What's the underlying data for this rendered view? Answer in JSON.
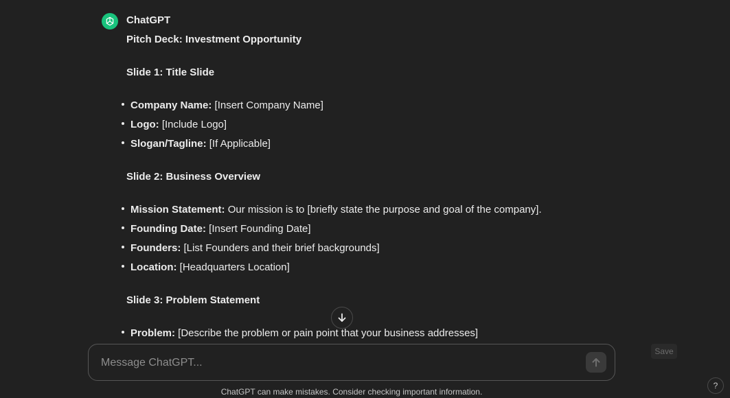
{
  "message": {
    "author": "ChatGPT",
    "avatar_icon": "openai-logo-icon",
    "avatar_color": "#19c37d",
    "title": "Pitch Deck: Investment Opportunity",
    "slides": [
      {
        "heading": "Slide 1: Title Slide",
        "items": [
          {
            "label": "Company Name:",
            "text": " [Insert Company Name]"
          },
          {
            "label": "Logo:",
            "text": " [Include Logo]"
          },
          {
            "label": "Slogan/Tagline:",
            "text": " [If Applicable]"
          }
        ]
      },
      {
        "heading": "Slide 2: Business Overview",
        "items": [
          {
            "label": "Mission Statement:",
            "text": " Our mission is to [briefly state the purpose and goal of the company]."
          },
          {
            "label": "Founding Date:",
            "text": " [Insert Founding Date]"
          },
          {
            "label": "Founders:",
            "text": " [List Founders and their brief backgrounds]"
          },
          {
            "label": "Location:",
            "text": " [Headquarters Location]"
          }
        ]
      },
      {
        "heading": "Slide 3: Problem Statement",
        "items": [
          {
            "label": "Problem:",
            "text": " [Describe the problem or pain point that your business addresses]"
          }
        ]
      }
    ]
  },
  "composer": {
    "placeholder": "Message ChatGPT...",
    "send_icon": "arrow-up-icon"
  },
  "scroll_icon": "arrow-down-icon",
  "save_label": "Save",
  "footer_text": "ChatGPT can make mistakes. Consider checking important information.",
  "help_label": "?"
}
